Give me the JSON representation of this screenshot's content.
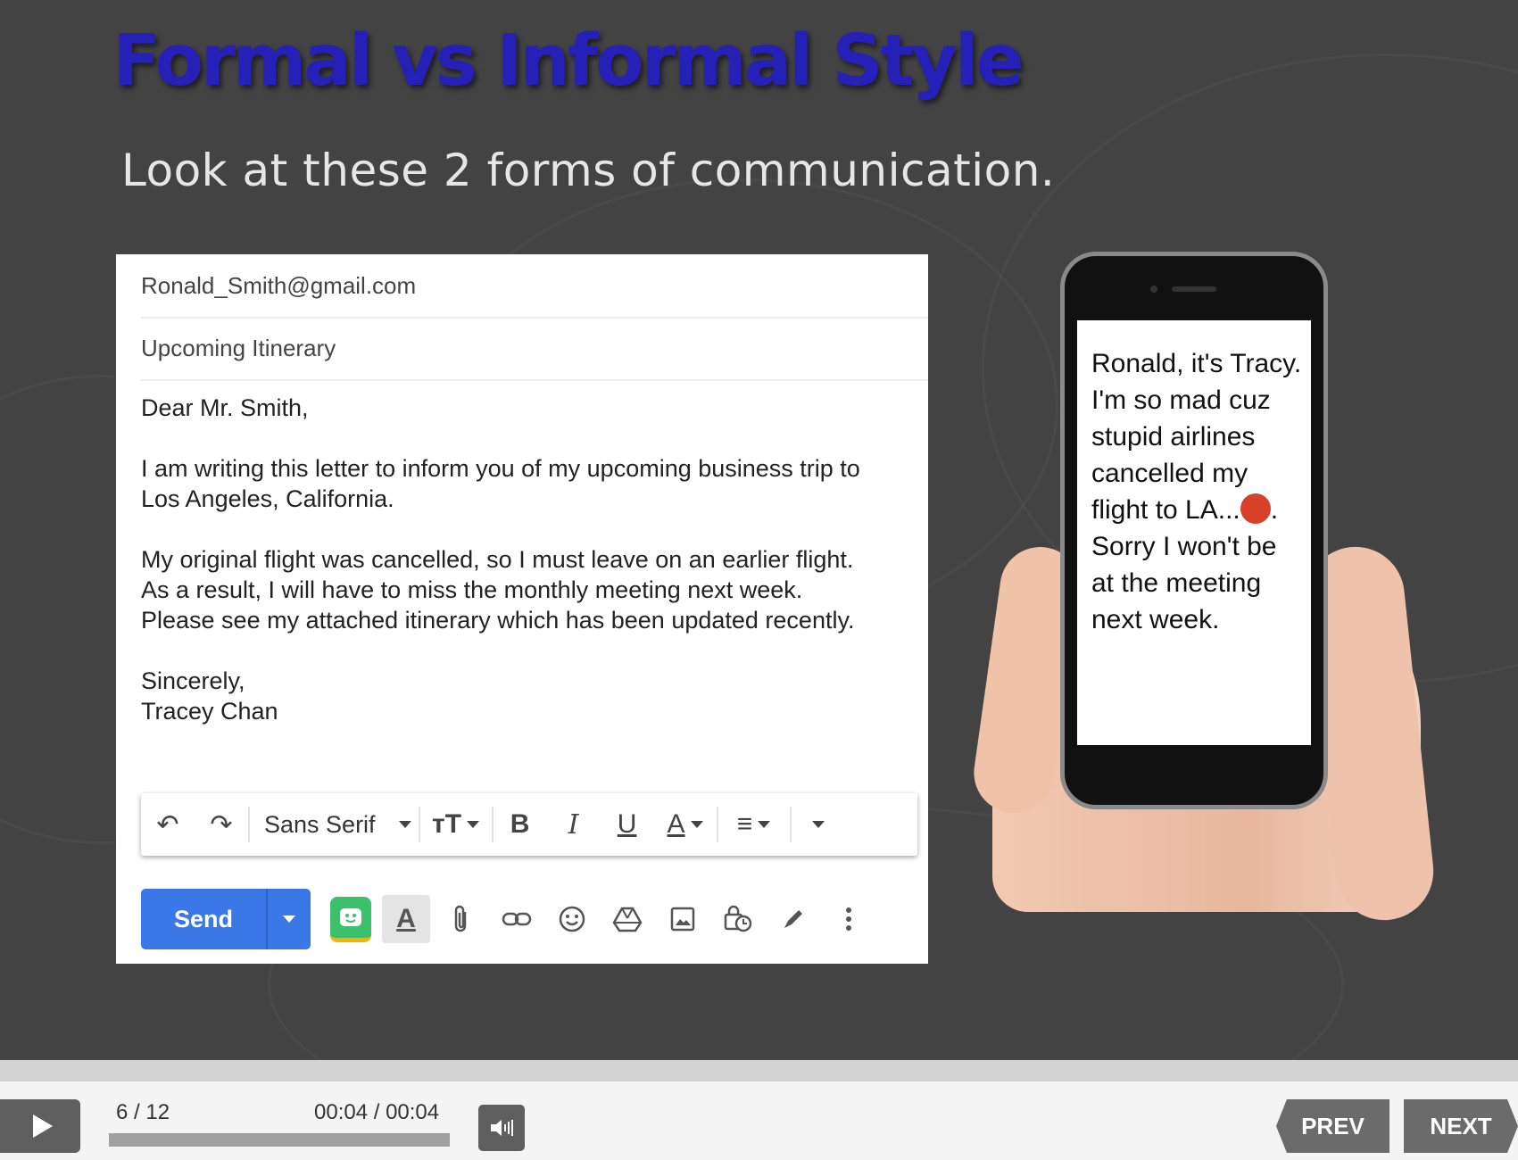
{
  "slide": {
    "title": "Formal vs Informal Style",
    "subtitle": "Look at these 2 forms of communication."
  },
  "email": {
    "to": "Ronald_Smith@gmail.com",
    "subject": "Upcoming Itinerary",
    "greeting": "Dear Mr. Smith,",
    "para1_line1": "I am writing this letter to inform you of my upcoming business trip to",
    "para1_line2": "Los Angeles, California.",
    "para2_line1": "My original flight was cancelled, so I must leave on an earlier flight.",
    "para2_line2": "As a result, I will have to miss the monthly meeting next week.",
    "para2_line3": "Please see my attached itinerary which has been updated recently.",
    "closing": "Sincerely,",
    "signature": "Tracey Chan",
    "toolbar": {
      "font": "Sans Serif",
      "undo_icon": "↶",
      "redo_icon": "↷",
      "text_size_icon": "тT",
      "bold_icon": "B",
      "italic_icon": "I",
      "underline_icon": "U",
      "text_color_icon": "A",
      "align_icon": "≡"
    },
    "send": {
      "label": "Send",
      "format_icon": "A"
    }
  },
  "phone": {
    "message_lines": [
      "Ronald, it's Tracy.",
      "I'm so mad cuz",
      "stupid airlines",
      "cancelled my",
      "flight to LA...",
      "Sorry I won't be",
      "at the meeting",
      "next week."
    ],
    "message_trail": "."
  },
  "player": {
    "slide_counter": "6 / 12",
    "time": "00:04 / 00:04",
    "progress": 1.0,
    "prev_label": "PREV",
    "next_label": "NEXT"
  }
}
